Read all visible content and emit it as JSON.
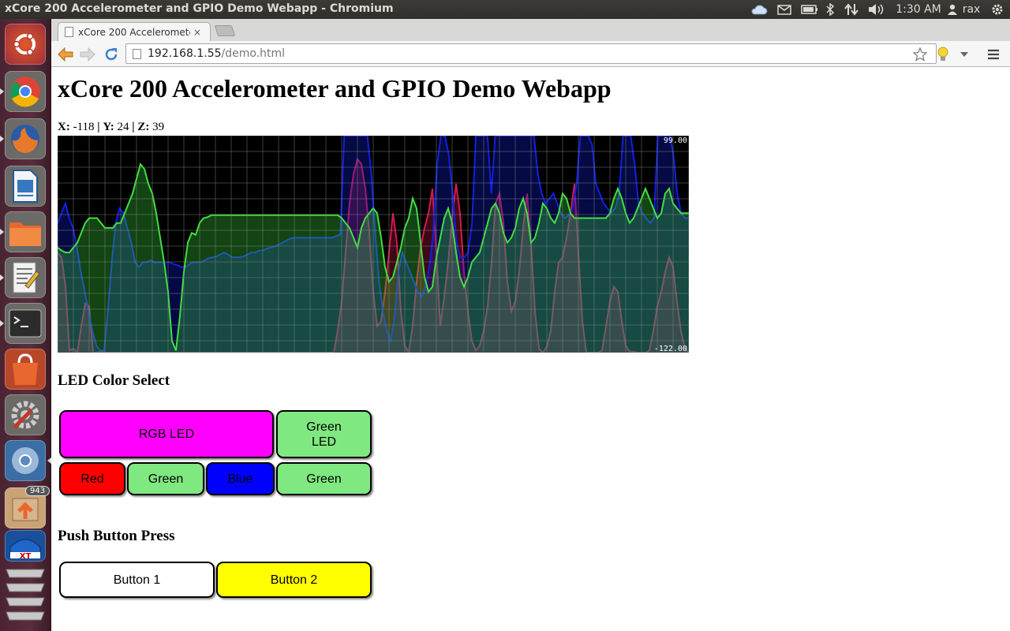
{
  "panel": {
    "window_title": "xCore 200 Accelerometer and GPIO Demo Webapp - Chromium",
    "time": "1:30 AM",
    "user": "rax"
  },
  "launcher": {
    "items": [
      "ubuntu-dash",
      "chromium",
      "firefox",
      "libreoffice-writer",
      "files",
      "text-editor",
      "terminal",
      "software-center",
      "system-settings",
      "chromium-app",
      "update-manager",
      "xmos-app",
      "workspace-stack"
    ],
    "update_badge": "943"
  },
  "browser": {
    "tab_title": "xCore 200 Acceleromete",
    "tab_close": "×",
    "url_host": "192.168.1.55",
    "url_path": "/demo.html"
  },
  "page": {
    "title": "xCore 200 Accelerometer and GPIO Demo Webapp",
    "readout": {
      "x_label": "X:",
      "x_value": "-118",
      "sep1": "|",
      "y_label": "Y:",
      "y_value": "24",
      "sep2": "|",
      "z_label": "Z:",
      "z_value": "39"
    },
    "led_heading": "LED Color Select",
    "led_buttons": {
      "rgb": "RGB LED",
      "green_led": "Green LED",
      "red": "Red",
      "green": "Green",
      "blue": "Blue",
      "green2": "Green"
    },
    "push_heading": "Push Button Press",
    "push_buttons": {
      "b1": "Button 1",
      "b2": "Button 2"
    }
  },
  "colors": {
    "rgb_led": "#ff00ff",
    "green": "#80e880",
    "red": "#ff0000",
    "blue": "#0000ff",
    "button2": "#ffff00",
    "button1": "#ffffff"
  },
  "chart_data": {
    "type": "area",
    "max_label": "99.00",
    "min_label": "-122.00",
    "ylim": [
      -122,
      99
    ],
    "grid": true,
    "series": [
      {
        "color": "#d01a4a",
        "values": [
          -20,
          -25,
          -55,
          -120,
          -118,
          -122,
          -95,
          -72,
          -75,
          -122,
          -122,
          -121,
          -122,
          -122,
          -122,
          -122,
          -122,
          -122,
          -122,
          -122,
          -122,
          -122,
          -122,
          -122,
          -122,
          -122,
          -122,
          -122,
          -122,
          -122,
          -122,
          -122,
          -122,
          -122,
          -122,
          -122,
          -122,
          -122,
          -122,
          -122,
          -122,
          -122,
          -122,
          -122,
          -122,
          -122,
          -122,
          -122,
          -122,
          -122,
          -122,
          -122,
          -122,
          -122,
          -122,
          -122,
          -122,
          -122,
          -122,
          -122,
          -122,
          -122,
          -122,
          -122,
          -122,
          -122,
          -122,
          -122,
          -122,
          -122,
          -122,
          -100,
          -70,
          -20,
          30,
          60,
          75,
          70,
          45,
          0,
          -60,
          -95,
          -90,
          -60,
          -20,
          20,
          -10,
          -80,
          -115,
          -122,
          -95,
          -50,
          -15,
          5,
          20,
          45,
          -20,
          -95,
          -65,
          -30,
          15,
          50,
          20,
          -40,
          -80,
          -110,
          -120,
          -115,
          -100,
          -75,
          -30,
          30,
          40,
          10,
          -50,
          -80,
          -70,
          -40,
          5,
          40,
          -10,
          -80,
          -118,
          -122,
          -116,
          -100,
          -60,
          -30,
          -25,
          -5,
          20,
          50,
          -20,
          -90,
          -122,
          -122,
          -122,
          -122,
          -120,
          -95,
          -70,
          -55,
          -60,
          -90,
          -115,
          -121,
          -121,
          -122,
          -122,
          -122,
          -120,
          -100,
          -75,
          -60,
          -40,
          -25,
          -35,
          -70,
          -100,
          -118,
          -122
        ]
      },
      {
        "color": "#1020e0",
        "values": [
          10,
          20,
          30,
          15,
          5,
          -15,
          -40,
          -60,
          -80,
          -100,
          -115,
          -120,
          -120,
          -80,
          -30,
          10,
          25,
          20,
          5,
          -10,
          -30,
          -35,
          -30,
          -30,
          -28,
          -30,
          -30,
          -30,
          -30,
          -30,
          -32,
          -33,
          -35,
          -35,
          -32,
          -30,
          -30,
          -30,
          -28,
          -26,
          -25,
          -24,
          -22,
          -20,
          -22,
          -25,
          -25,
          -25,
          -24,
          -22,
          -20,
          -20,
          -18,
          -18,
          -16,
          -15,
          -14,
          -12,
          -10,
          -8,
          -6,
          -5,
          -5,
          -5,
          -5,
          -5,
          -5,
          -5,
          -5,
          -5,
          -5,
          -5,
          -3,
          -2,
          99,
          99,
          99,
          99,
          99,
          99,
          99,
          60,
          0,
          -50,
          -80,
          -100,
          -110,
          -85,
          -40,
          -20,
          -30,
          -40,
          -50,
          -60,
          -65,
          -55,
          -35,
          0,
          70,
          99,
          99,
          80,
          40,
          -10,
          -25,
          -25,
          -20,
          10,
          99,
          99,
          99,
          99,
          40,
          99,
          99,
          99,
          99,
          99,
          99,
          99,
          99,
          99,
          99,
          99,
          60,
          40,
          30,
          35,
          40,
          30,
          20,
          15,
          18,
          25,
          50,
          99,
          99,
          99,
          90,
          50,
          40,
          30,
          25,
          20,
          25,
          40,
          99,
          99,
          99,
          70,
          30,
          20,
          15,
          10,
          15,
          99,
          99,
          99,
          99,
          80,
          40,
          20,
          15,
          15
        ]
      },
      {
        "color": "#40e040",
        "values": [
          -15,
          -18,
          -20,
          -20,
          -15,
          -10,
          0,
          10,
          15,
          15,
          15,
          10,
          5,
          5,
          5,
          10,
          10,
          20,
          30,
          40,
          55,
          70,
          65,
          50,
          40,
          20,
          -5,
          -30,
          -60,
          -110,
          -120,
          -85,
          -40,
          -10,
          0,
          -2,
          10,
          15,
          16,
          18,
          18,
          18,
          18,
          18,
          18,
          18,
          18,
          18,
          18,
          18,
          18,
          18,
          18,
          18,
          18,
          18,
          18,
          18,
          18,
          18,
          18,
          18,
          18,
          18,
          18,
          18,
          18,
          18,
          18,
          18,
          18,
          18,
          15,
          10,
          5,
          -5,
          -15,
          5,
          15,
          20,
          25,
          20,
          -5,
          -35,
          -50,
          -45,
          -30,
          -15,
          5,
          15,
          35,
          25,
          -10,
          -45,
          -60,
          -55,
          -25,
          -5,
          15,
          25,
          10,
          -20,
          -45,
          -55,
          -45,
          -30,
          -25,
          -20,
          -5,
          10,
          25,
          30,
          20,
          0,
          -10,
          -5,
          5,
          25,
          35,
          20,
          -10,
          -5,
          10,
          30,
          25,
          15,
          10,
          20,
          40,
          35,
          20,
          15,
          15,
          15,
          15,
          15,
          15,
          15,
          15,
          15,
          20,
          35,
          45,
          35,
          20,
          10,
          15,
          25,
          35,
          45,
          35,
          25,
          15,
          20,
          40,
          45,
          30,
          25,
          20,
          20,
          20
        ]
      }
    ]
  }
}
